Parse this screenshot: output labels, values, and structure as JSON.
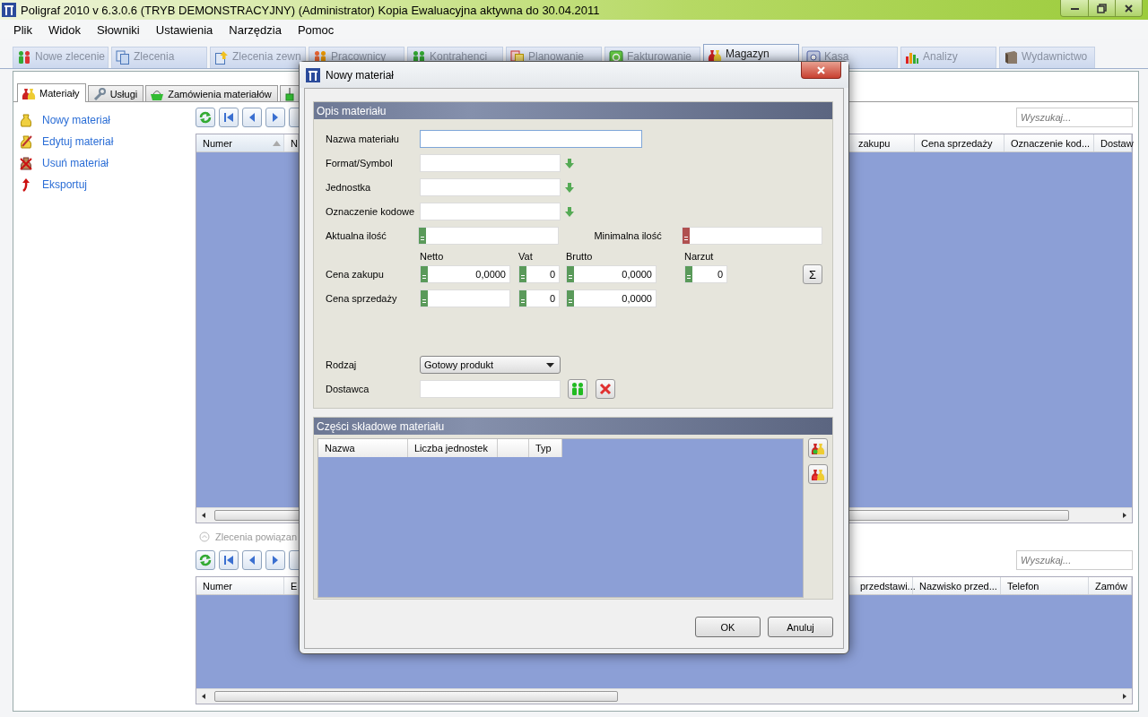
{
  "window": {
    "title": "Poligraf 2010 v 6.3.0.6 (TRYB DEMONSTRACYJNY) (Administrator) Kopia Ewaluacyjna aktywna do 30.04.2011"
  },
  "menu": [
    "Plik",
    "Widok",
    "Słowniki",
    "Ustawienia",
    "Narzędzia",
    "Pomoc"
  ],
  "main_tabs": [
    {
      "label": "Nowe zlecenie",
      "selected": false
    },
    {
      "label": "Zlecenia",
      "selected": false
    },
    {
      "label": "Zlecenia zewn",
      "selected": false
    },
    {
      "label": "Pracownicy",
      "selected": false
    },
    {
      "label": "Kontrahenci",
      "selected": false
    },
    {
      "label": "Planowanie",
      "selected": false
    },
    {
      "label": "Fakturowanie",
      "selected": false
    },
    {
      "label": "Magazyn",
      "selected": true
    },
    {
      "label": "Kasa",
      "selected": false
    },
    {
      "label": "Analizy",
      "selected": false
    },
    {
      "label": "Wydawnictwo",
      "selected": false
    }
  ],
  "sub_tabs": [
    {
      "label": "Materiały",
      "selected": true
    },
    {
      "label": "Usługi",
      "selected": false
    },
    {
      "label": "Zamówienia materiałów",
      "selected": false
    }
  ],
  "sidebar": {
    "actions": [
      "Nowy materiał",
      "Edytuj materiał",
      "Usuń materiał",
      "Eksportuj"
    ]
  },
  "materials_grid": {
    "search": {
      "placeholder": "Wyszukaj..."
    },
    "columns_left": [
      {
        "label": "Numer",
        "sorted": true
      },
      {
        "label": "N",
        "sorted": false
      }
    ],
    "columns_right": [
      {
        "label": "zakupu",
        "sorted": false
      },
      {
        "label": "Cena sprzedaży",
        "sorted": false
      },
      {
        "label": "Oznaczenie kod...",
        "sorted": false
      },
      {
        "label": "Dostaw",
        "sorted": false
      }
    ]
  },
  "related_orders": {
    "title": "Zlecenia powiązan",
    "search": {
      "placeholder": "Wyszukaj..."
    },
    "columns_left": [
      {
        "label": "Numer",
        "sorted": false
      },
      {
        "label": "E",
        "sorted": false
      }
    ],
    "columns_right": [
      {
        "label": "przedstawi...",
        "sorted": false
      },
      {
        "label": "Nazwisko przed...",
        "sorted": false
      },
      {
        "label": "Telefon",
        "sorted": false
      },
      {
        "label": "Zamów",
        "sorted": false
      }
    ]
  },
  "dialog": {
    "title": "Nowy materiał",
    "description": {
      "title": "Opis materiału",
      "name_field": {
        "label": "Nazwa materiału",
        "focused": true
      },
      "lookup_fields": [
        {
          "label": "Format/Symbol"
        },
        {
          "label": "Jednostka"
        },
        {
          "label": "Oznaczenie kodowe"
        }
      ],
      "current_qty": {
        "label": "Aktualna ilość"
      },
      "min_qty": {
        "label": "Minimalna ilość"
      },
      "price_headers": [
        "Netto",
        "Vat",
        "Brutto",
        "Narzut"
      ],
      "price_rows": [
        {
          "label": "Cena zakupu",
          "netto": "0,0000",
          "vat": "0",
          "brutto": "0,0000",
          "narzut": "0"
        },
        {
          "label": "Cena sprzedaży",
          "vat": "0",
          "brutto": "0,0000"
        }
      ],
      "sum_button": "Σ",
      "kind_field": {
        "label": "Rodzaj",
        "value": "Gotowy produkt"
      },
      "supplier_field": {
        "label": "Dostawca"
      }
    },
    "parts": {
      "title": "Części składowe materiału",
      "columns": [
        {
          "label": "Nazwa"
        },
        {
          "label": "Liczba jednostek"
        },
        {},
        {
          "label": "Typ"
        }
      ]
    },
    "buttons": [
      "OK",
      "Anuluj"
    ]
  }
}
